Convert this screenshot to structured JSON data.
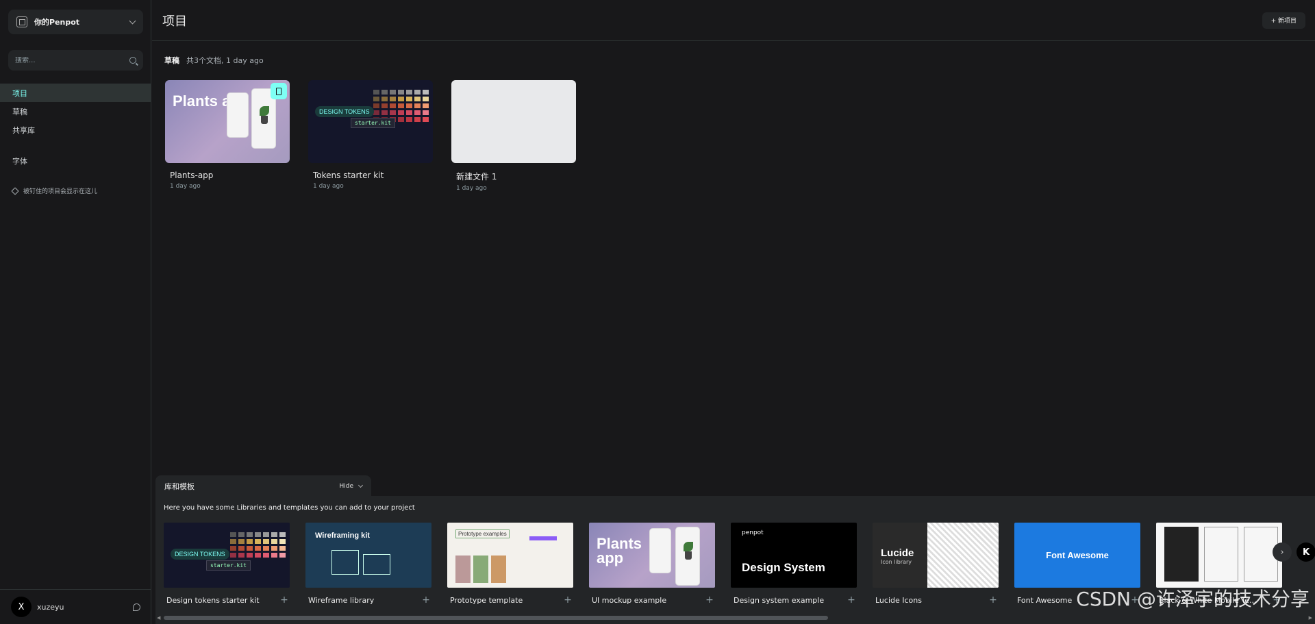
{
  "team": {
    "name": "你的Penpot"
  },
  "search": {
    "placeholder": "搜索..."
  },
  "nav": {
    "items": [
      {
        "label": "项目"
      },
      {
        "label": "草稿"
      },
      {
        "label": "共享库"
      },
      {
        "label": "字体"
      }
    ]
  },
  "pinned_hint": "被钉住的项目会显示在这儿",
  "profile": {
    "avatar_letter": "X",
    "name": "xuzeyu"
  },
  "header": {
    "title": "项目",
    "new_project_label": "+ 新项目"
  },
  "project": {
    "name": "草稿",
    "meta": "共3个文档, 1 day ago"
  },
  "files": [
    {
      "name": "Plants-app",
      "date": "1 day ago",
      "thumb_title": "Plants app"
    },
    {
      "name": "Tokens starter kit",
      "date": "1 day ago",
      "thumb_title": "DESIGN TOKENS",
      "thumb_sub": "starter.kit"
    },
    {
      "name": "新建文件 1",
      "date": "1 day ago"
    }
  ],
  "libraries": {
    "title": "库和模板",
    "hide_label": "Hide",
    "subtitle": "Here you have some Libraries and templates you can add to your project",
    "cards": [
      {
        "name": "Design tokens starter kit",
        "thumb_title": "DESIGN TOKENS",
        "thumb_sub": "starter.kit"
      },
      {
        "name": "Wireframe library",
        "thumb_title": "Wireframing kit"
      },
      {
        "name": "Prototype template",
        "thumb_title": "Prototype examples"
      },
      {
        "name": "UI mockup example",
        "thumb_title": "Plants app"
      },
      {
        "name": "Design system example",
        "thumb_brand": "penpot",
        "thumb_title": "Design System"
      },
      {
        "name": "Lucide Icons",
        "thumb_title": "Lucide",
        "thumb_sub": "Icon library"
      },
      {
        "name": "Font Awesome",
        "thumb_title": "Font Awesome"
      },
      {
        "name": "Black & White Mobile Te..."
      }
    ]
  },
  "watermark": "CSDN @许泽宇的技术分享",
  "colors": {
    "accent": "#7efff5",
    "bg": "#18181a",
    "panel": "#232527"
  }
}
